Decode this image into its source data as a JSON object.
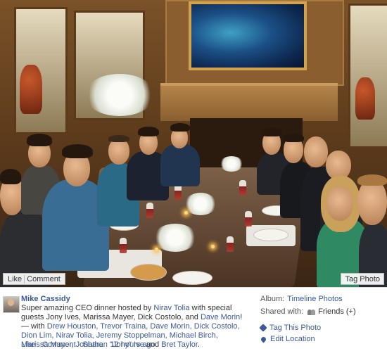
{
  "photo": {
    "description_alt": "",
    "like_label": "Like",
    "comment_label": "Comment",
    "tag_photo_label": "Tag Photo"
  },
  "post": {
    "author": "Mike Cassidy",
    "text_before": "Super amazing CEO dinner hosted by ",
    "host": "Nirav Tolia",
    "text_mid1": " with special guests Jony Ives, Marissa Mayer, Dick Costolo, and ",
    "guest_link": "Dave Morin",
    "text_mid2": "! — with ",
    "tagged": "Drew Houston, Trevor Traina, Dave Morin, Dick Costolo, Dion Lim, Nirav Tolia, Jeremy Stoppelman, Michael Birch, Marissa Mayer, Jonathan \"Jony\" Ive",
    "text_mid3": " and ",
    "last_tag": "Bret Taylor",
    "text_end": "."
  },
  "actions": {
    "like": "Like",
    "comment": "Comment",
    "share": "Share",
    "sep": " · ",
    "time": "12 hours ago"
  },
  "meta": {
    "album_label": "Album:",
    "album_value": "Timeline Photos",
    "shared_label": "Shared with:",
    "shared_value": "Friends (+)",
    "tag_this_photo": "Tag This Photo",
    "edit_location": "Edit Location"
  },
  "colors": {
    "link": "#3b5998",
    "text": "#333333"
  }
}
